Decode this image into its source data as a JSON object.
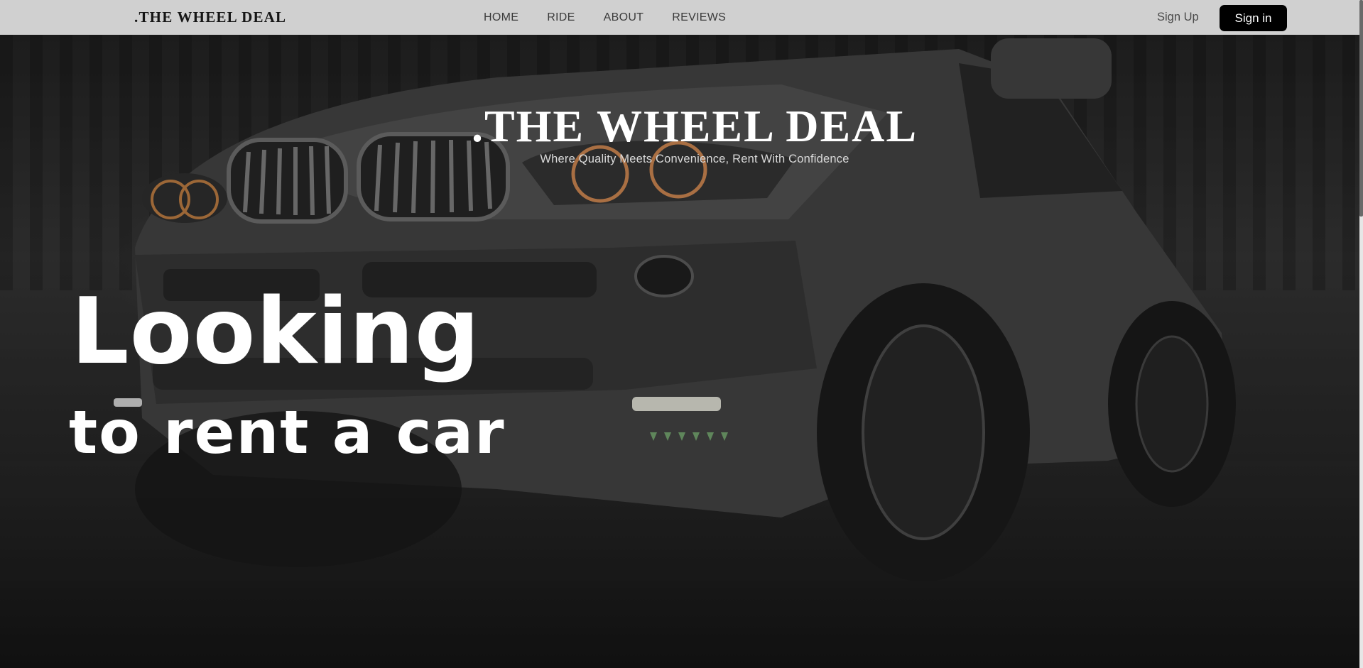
{
  "nav": {
    "brand": ".THE WHEEL DEAL",
    "menu": [
      "HOME",
      "RIDE",
      "ABOUT",
      "REVIEWS"
    ],
    "signup_label": "Sign Up",
    "signin_label": "Sign in"
  },
  "hero": {
    "title": ".THE WHEEL DEAL",
    "subtitle": "Where Quality Meets Convenience, Rent With Confidence",
    "headline_line1": "Looking",
    "headline_line2": "to rent a car",
    "background_image": "dark-grey-suv-night-photo"
  },
  "colors": {
    "nav_bg": "#d0d0d0",
    "button_bg": "#000000",
    "text_light": "#ffffff"
  }
}
